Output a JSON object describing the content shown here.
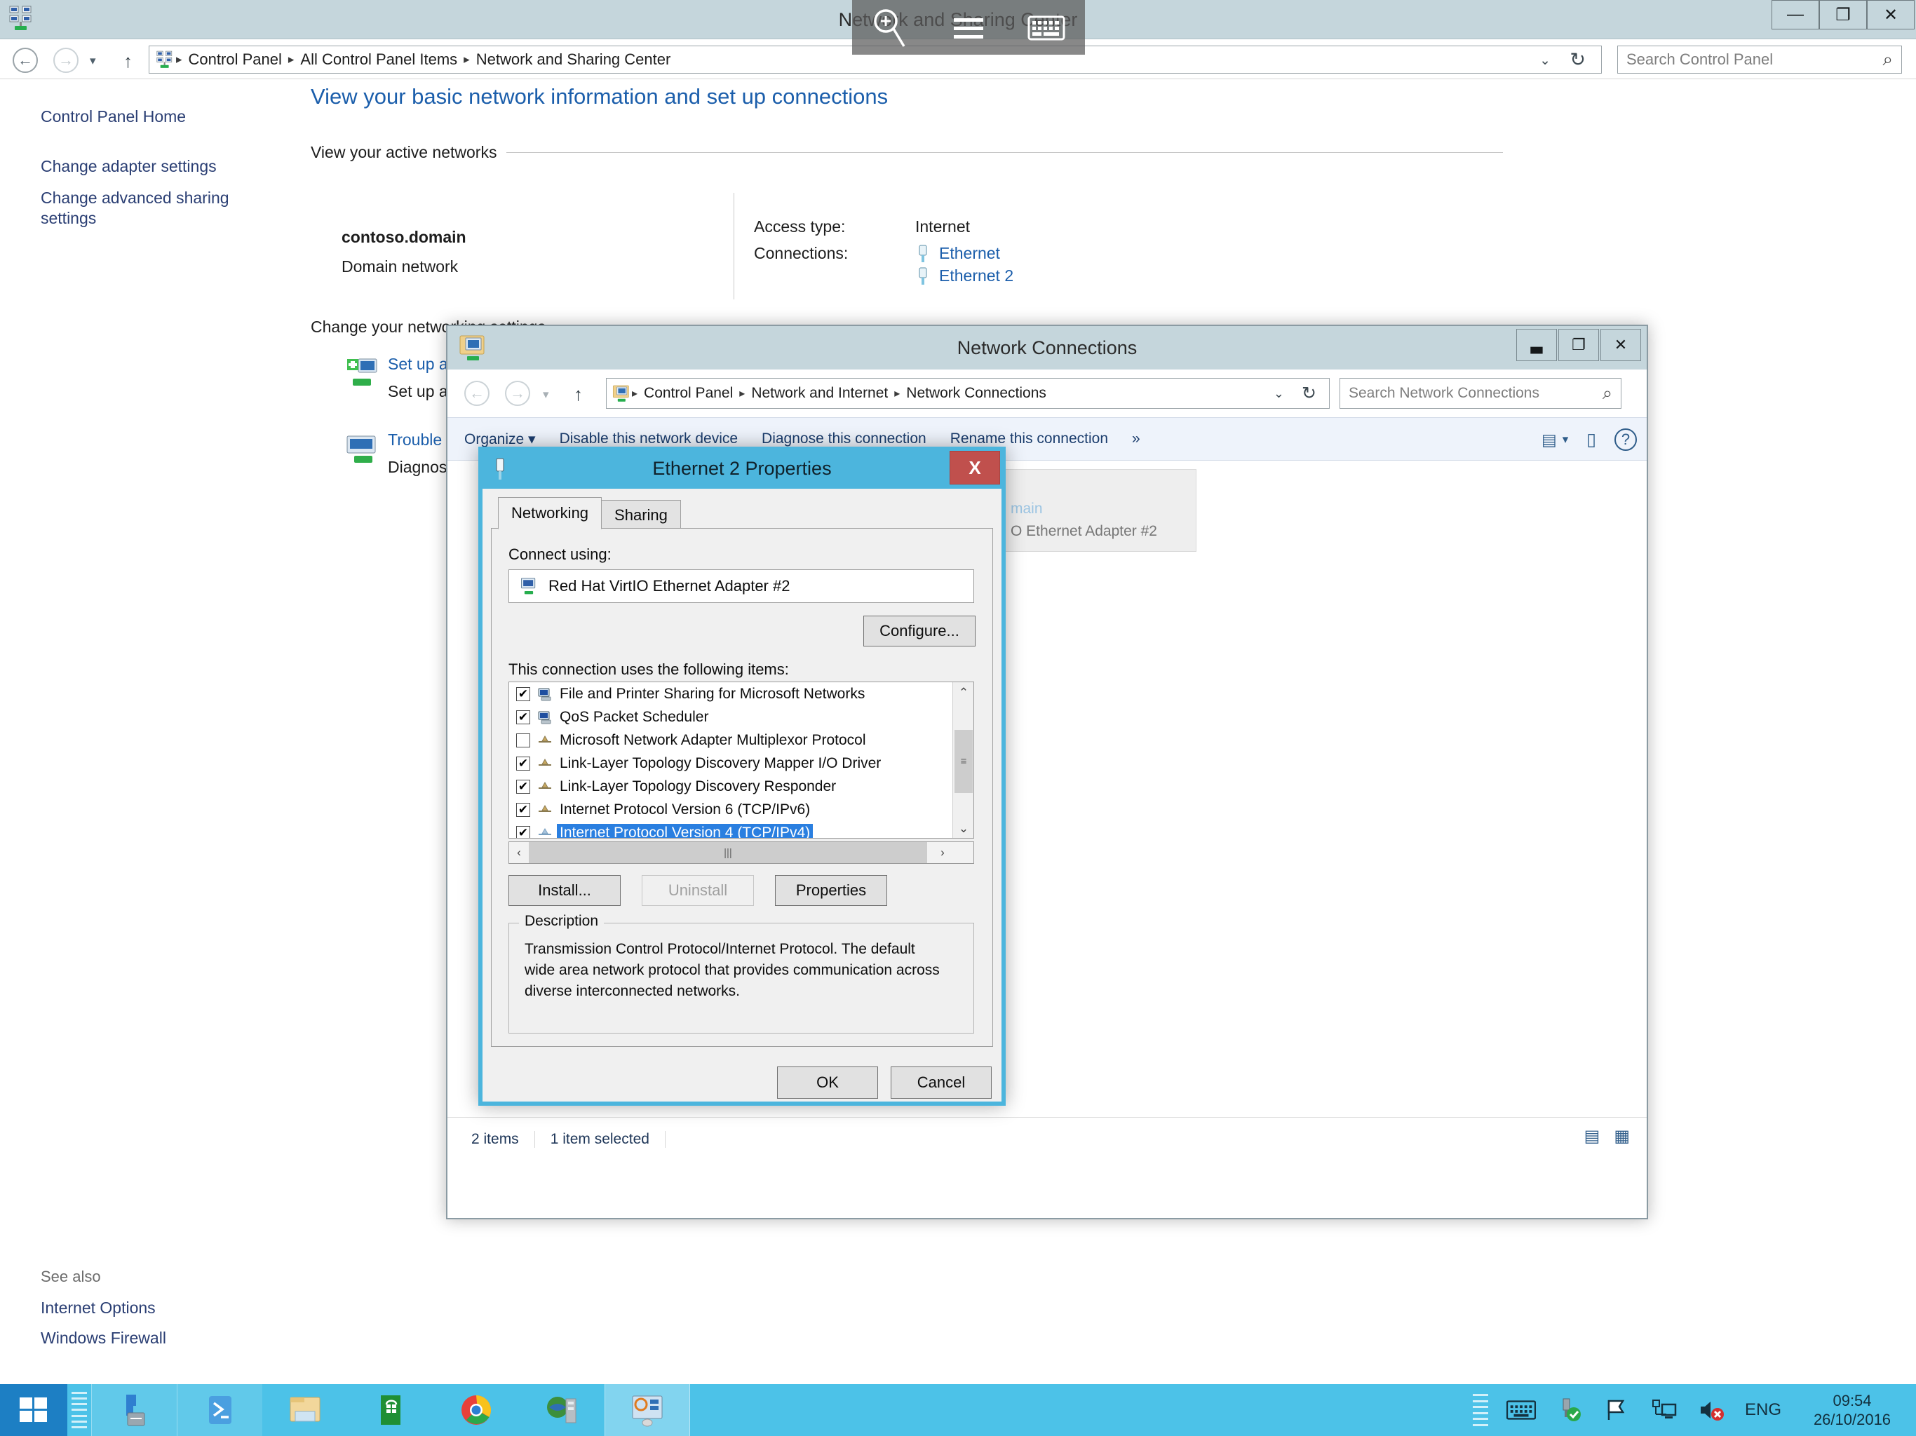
{
  "control_panel": {
    "title": "Network and Sharing Center",
    "window_buttons": {
      "minimize": "—",
      "maximize": "❐",
      "close": "✕"
    },
    "nav": {
      "back": "←",
      "forward": "→",
      "recent": "▾",
      "up": "↑"
    },
    "breadcrumb": [
      "Control Panel",
      "All Control Panel Items",
      "Network and Sharing Center"
    ],
    "breadcrumb_separator": "▸",
    "address_chevron": "⌄",
    "address_refresh": "↻",
    "search": {
      "placeholder": "Search Control Panel",
      "icon": "⌕"
    },
    "left_nav": {
      "home": "Control Panel Home",
      "adapter_settings": "Change adapter settings",
      "advanced_sharing": "Change advanced sharing settings"
    },
    "see_also": {
      "heading": "See also",
      "links": [
        "Internet Options",
        "Windows Firewall"
      ]
    },
    "main": {
      "heading": "View your basic network information and set up connections",
      "active_networks_header": "View your active networks",
      "network": {
        "name": "contoso.domain",
        "type": "Domain network"
      },
      "access_type_label": "Access type:",
      "access_type_value": "Internet",
      "connections_label": "Connections:",
      "connections": [
        "Ethernet",
        "Ethernet 2"
      ],
      "change_settings_header": "Change your networking settings",
      "tasks": [
        {
          "link": "Set up a new connection or network",
          "desc": "Set up a"
        },
        {
          "link": "Trouble",
          "desc": "Diagnos"
        }
      ]
    }
  },
  "network_connections": {
    "title": "Network Connections",
    "window_buttons": {
      "minimize": "▃",
      "maximize": "❐",
      "close": "✕"
    },
    "nav": {
      "back": "←",
      "forward": "→",
      "recent": "▾",
      "up": "↑"
    },
    "breadcrumb": [
      "Control Panel",
      "Network and Internet",
      "Network Connections"
    ],
    "breadcrumb_separator": "▸",
    "address_chevron": "⌄",
    "address_refresh": "↻",
    "search": {
      "placeholder": "Search Network Connections",
      "icon": "⌕"
    },
    "toolbar": {
      "organize": "Organize ▾",
      "disable": "Disable this network device",
      "diagnose": "Diagnose this connection",
      "rename": "Rename this connection",
      "overflow": "»",
      "view_icon": "▤",
      "view_chevron": "▾",
      "pane_icon": "▯",
      "help_icon": "?"
    },
    "list_item": {
      "line1": "main",
      "line2": "O Ethernet Adapter #2"
    },
    "status": {
      "items": "2 items",
      "selected": "1 item selected"
    },
    "status_view_icons": [
      "▤",
      "▦"
    ]
  },
  "properties_dialog": {
    "title": "Ethernet 2 Properties",
    "close_label": "X",
    "tabs": [
      {
        "label": "Networking",
        "active": true
      },
      {
        "label": "Sharing",
        "active": false
      }
    ],
    "connect_using_label": "Connect using:",
    "adapter_name": "Red Hat VirtIO Ethernet Adapter #2",
    "configure_button": "Configure...",
    "items_label": "This connection uses the following items:",
    "protocols": [
      {
        "label": "File and Printer Sharing for Microsoft Networks",
        "checked": true,
        "selected": false,
        "icon": "computer"
      },
      {
        "label": "QoS Packet Scheduler",
        "checked": true,
        "selected": false,
        "icon": "computer"
      },
      {
        "label": "Microsoft Network Adapter Multiplexor Protocol",
        "checked": false,
        "selected": false,
        "icon": "protocol"
      },
      {
        "label": "Link-Layer Topology Discovery Mapper I/O Driver",
        "checked": true,
        "selected": false,
        "icon": "protocol"
      },
      {
        "label": "Link-Layer Topology Discovery Responder",
        "checked": true,
        "selected": false,
        "icon": "protocol"
      },
      {
        "label": "Internet Protocol Version 6 (TCP/IPv6)",
        "checked": true,
        "selected": false,
        "icon": "protocol"
      },
      {
        "label": "Internet Protocol Version 4 (TCP/IPv4)",
        "checked": true,
        "selected": true,
        "icon": "protocol"
      }
    ],
    "scroll": {
      "up_arrow": "⌃",
      "down_arrow": "⌄",
      "grip": "≡",
      "left_arrow": "‹",
      "right_arrow": "›",
      "h_grip": "|||"
    },
    "buttons": {
      "install": "Install...",
      "uninstall": "Uninstall",
      "properties": "Properties",
      "ok": "OK",
      "cancel": "Cancel"
    },
    "uninstall_disabled": true,
    "description_legend": "Description",
    "description_text": "Transmission Control Protocol/Internet Protocol. The default wide area network protocol that provides communication across diverse interconnected networks."
  },
  "overlay_toolbar": {
    "icons": [
      "magnifier-zoom-in",
      "menu-hamburger",
      "on-screen-keyboard"
    ]
  },
  "taskbar": {
    "start_label": "Start",
    "apps": [
      {
        "name": "server-manager",
        "state": "pinned"
      },
      {
        "name": "powershell",
        "state": "pinned"
      },
      {
        "name": "file-explorer",
        "state": "running"
      },
      {
        "name": "store",
        "state": "running"
      },
      {
        "name": "chrome",
        "state": "running"
      },
      {
        "name": "internet-explorer-server",
        "state": "running"
      },
      {
        "name": "control-panel",
        "state": "active"
      }
    ],
    "tray": {
      "keyboard": "on-screen-keyboard",
      "usb": "safely-remove-hardware",
      "flag": "action-center",
      "network": "network-status",
      "volume": "volume-muted",
      "language": "ENG",
      "time": "09:54",
      "date": "26/10/2016"
    }
  },
  "colors": {
    "titlebar": "#c5d6dc",
    "dialog_accent": "#4cb5dd",
    "taskbar": "#4cc2e8",
    "link": "#1b5eab",
    "selection": "#2a7fe0",
    "close_red": "#c0504d"
  }
}
